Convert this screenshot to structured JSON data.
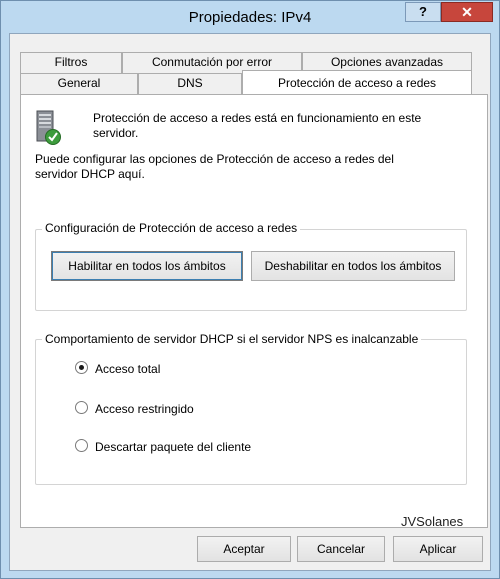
{
  "window": {
    "title": "Propiedades: IPv4",
    "help_label": "?",
    "close_label": "✕"
  },
  "tabs": {
    "row1": [
      "Filtros",
      "Conmutación por error",
      "Opciones avanzadas"
    ],
    "row2": [
      "General",
      "DNS",
      "Protección de acceso a redes"
    ],
    "active": "Protección de acceso a redes"
  },
  "panel": {
    "status_text_line1": "Protección de acceso a redes está en funcionamiento en este",
    "status_text_line2": "servidor.",
    "info_line1": "Puede configurar las opciones de Protección de acceso a redes del",
    "info_line2": "servidor DHCP aquí.",
    "icon": "server-check-icon"
  },
  "nap_config": {
    "legend": "Configuración de Protección de acceso a redes",
    "enable_all_label": "Habilitar en todos los ámbitos",
    "disable_all_label": "Deshabilitar en todos los ámbitos"
  },
  "dhcp_behavior": {
    "legend": "Comportamiento de servidor DHCP si el servidor NPS es inalcanzable",
    "options": [
      {
        "label": "Acceso total",
        "selected": true
      },
      {
        "label": "Acceso restringido",
        "selected": false
      },
      {
        "label": "Descartar paquete del cliente",
        "selected": false
      }
    ]
  },
  "watermark": "JVSolanes",
  "buttons": {
    "ok": "Aceptar",
    "cancel": "Cancelar",
    "apply": "Aplicar"
  }
}
